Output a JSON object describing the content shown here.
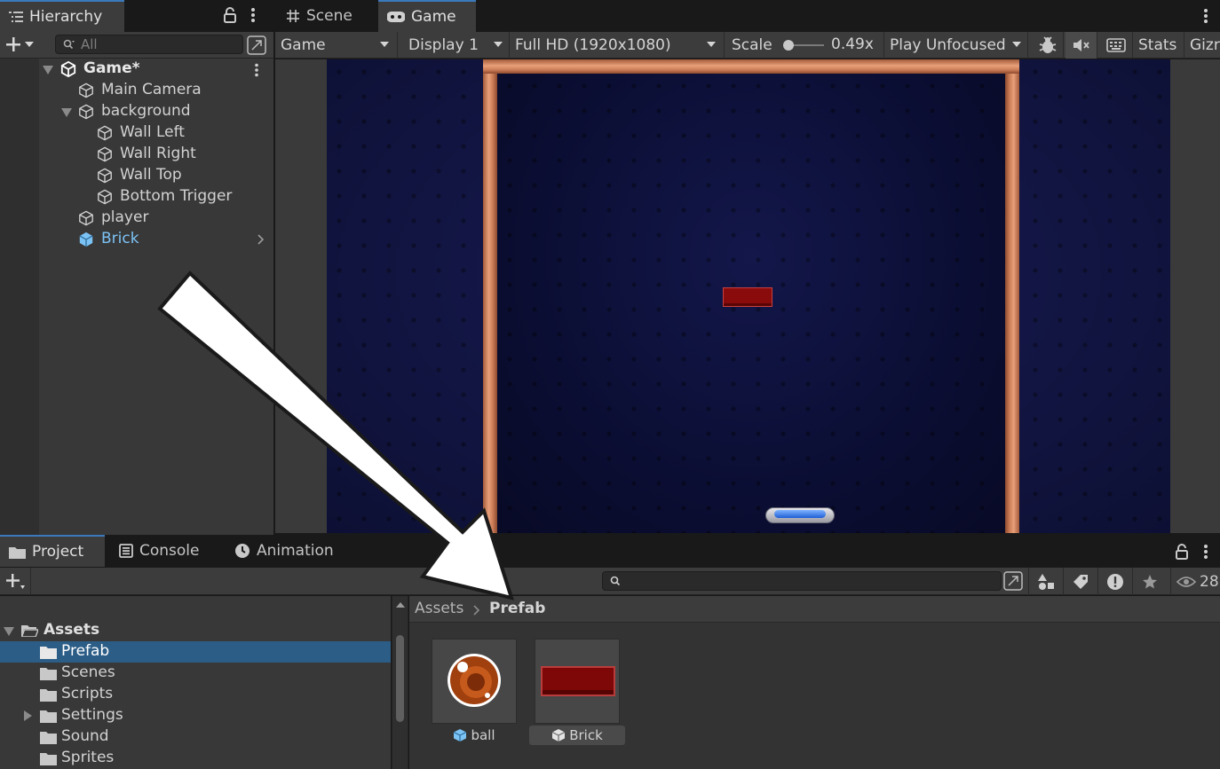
{
  "hierarchy": {
    "tab_label": "Hierarchy",
    "search_placeholder": "All",
    "scene_name": "Game*",
    "items": [
      {
        "label": "Main Camera"
      },
      {
        "label": "background"
      },
      {
        "label": "Wall Left"
      },
      {
        "label": "Wall Right"
      },
      {
        "label": "Wall Top"
      },
      {
        "label": "Bottom Trigger"
      },
      {
        "label": "player"
      },
      {
        "label": "Brick"
      }
    ]
  },
  "view_tabs": {
    "scene_label": "Scene",
    "game_label": "Game"
  },
  "game_toolbar": {
    "mode": "Game",
    "display": "Display 1",
    "resolution": "Full HD (1920x1080)",
    "scale_label": "Scale",
    "scale_value": "0.49x",
    "play_mode": "Play Unfocused",
    "stats_label": "Stats",
    "gizmos_label": "Gizr"
  },
  "bottom_tabs": {
    "project_label": "Project",
    "console_label": "Console",
    "animation_label": "Animation"
  },
  "project": {
    "visible_count": "28",
    "tree_root": "Assets",
    "tree_items": [
      {
        "label": "Prefab"
      },
      {
        "label": "Scenes"
      },
      {
        "label": "Scripts"
      },
      {
        "label": "Settings"
      },
      {
        "label": "Sound"
      },
      {
        "label": "Sprites"
      }
    ],
    "breadcrumb": {
      "root": "Assets",
      "current": "Prefab"
    },
    "assets": [
      {
        "label": "ball"
      },
      {
        "label": "Brick"
      }
    ]
  },
  "colors": {
    "selection": "#2c5d87",
    "prefab_blue": "#7cc3f5",
    "brick_red": "#8a0b0b",
    "frame_copper": "#d68a62",
    "active_tab_accent": "#3a79bb"
  },
  "icons": [
    "hierarchy-list-icon",
    "lock-icon",
    "kebab-menu-icon",
    "scene-grid-icon",
    "gamepad-icon",
    "plus-icon",
    "search-icon",
    "unity-logo-icon",
    "gameobject-cube-icon",
    "prefab-cube-icon",
    "folder-icon",
    "console-icon",
    "animation-clock-icon",
    "bug-icon",
    "mute-audio-icon",
    "keyboard-icon",
    "filter-by-type-icon",
    "label-tag-icon",
    "warning-icon",
    "favorite-star-icon",
    "eye-icon"
  ]
}
